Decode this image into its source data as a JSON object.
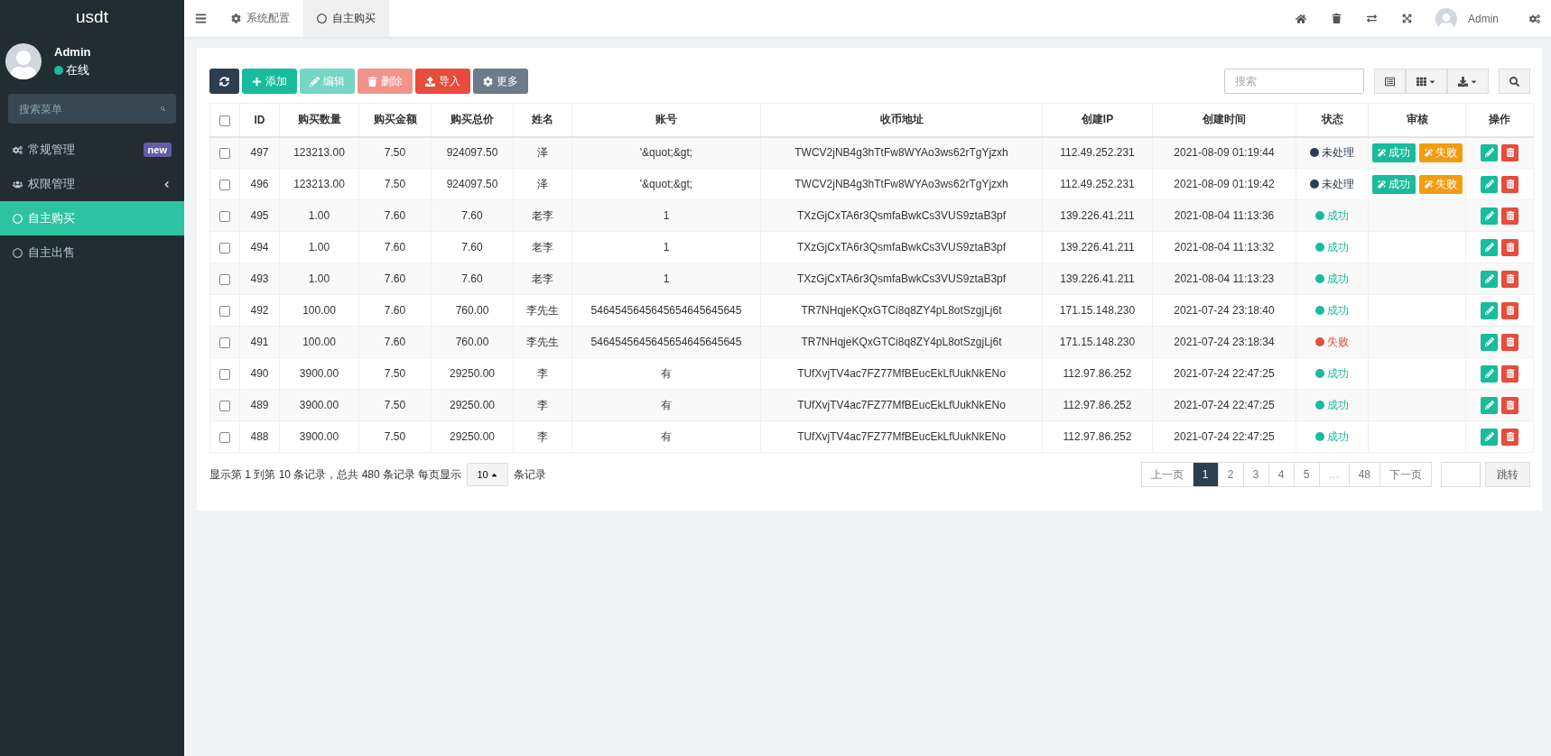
{
  "sidebar": {
    "logo": "usdt",
    "user": {
      "name": "Admin",
      "status": "在线"
    },
    "search": {
      "placeholder": "搜索菜单"
    },
    "items": [
      {
        "label": "常规管理",
        "badge": "new",
        "selected": false
      },
      {
        "label": "权限管理",
        "selected": false
      },
      {
        "label": "自主购买",
        "selected": true
      },
      {
        "label": "自主出售",
        "selected": false
      }
    ]
  },
  "topbar": {
    "tabs": [
      {
        "label": "系统配置",
        "selected": false
      },
      {
        "label": "自主购买",
        "selected": true
      }
    ],
    "user": "Admin"
  },
  "toolbar": {
    "buttons": [
      {
        "kind": "refresh",
        "disabled": false
      },
      {
        "kind": "add",
        "label": "添加",
        "disabled": false
      },
      {
        "kind": "edit",
        "label": "编辑",
        "disabled": true
      },
      {
        "kind": "delete",
        "label": "删除",
        "disabled": true
      },
      {
        "kind": "import",
        "label": "导入",
        "disabled": false
      },
      {
        "kind": "more",
        "label": "更多",
        "disabled": false
      }
    ],
    "search": {
      "placeholder": "搜索"
    }
  },
  "table": {
    "select_all": {
      "checked": false
    },
    "columns": [
      "ID",
      "购买数量",
      "购买金额",
      "购买总价",
      "姓名",
      "账号",
      "收币地址",
      "创建IP",
      "创建时间",
      "状态",
      "审核",
      "操作"
    ],
    "rows": [
      {
        "checked": false,
        "cells": [
          "497",
          "123213.00",
          "7.50",
          "924097.50",
          "泽",
          "'&quot;&gt;",
          "TWCV2jNB4g3hTtFw8WYAo3ws62rTgYjzxh",
          "112.49.252.231",
          "2021-08-09 01:19:44"
        ],
        "status": {
          "kind": "pending",
          "label": "未处理"
        },
        "review": [
          "成功",
          "失败"
        ]
      },
      {
        "checked": false,
        "cells": [
          "496",
          "123213.00",
          "7.50",
          "924097.50",
          "泽",
          "'&quot;&gt;",
          "TWCV2jNB4g3hTtFw8WYAo3ws62rTgYjzxh",
          "112.49.252.231",
          "2021-08-09 01:19:42"
        ],
        "status": {
          "kind": "pending",
          "label": "未处理"
        },
        "review": [
          "成功",
          "失败"
        ]
      },
      {
        "checked": false,
        "cells": [
          "495",
          "1.00",
          "7.60",
          "7.60",
          "老李",
          "1",
          "TXzGjCxTA6r3QsmfaBwkCs3VUS9ztaB3pf",
          "139.226.41.211",
          "2021-08-04 11:13:36"
        ],
        "status": {
          "kind": "success",
          "label": "成功"
        }
      },
      {
        "checked": false,
        "cells": [
          "494",
          "1.00",
          "7.60",
          "7.60",
          "老李",
          "1",
          "TXzGjCxTA6r3QsmfaBwkCs3VUS9ztaB3pf",
          "139.226.41.211",
          "2021-08-04 11:13:32"
        ],
        "status": {
          "kind": "success",
          "label": "成功"
        }
      },
      {
        "checked": false,
        "cells": [
          "493",
          "1.00",
          "7.60",
          "7.60",
          "老李",
          "1",
          "TXzGjCxTA6r3QsmfaBwkCs3VUS9ztaB3pf",
          "139.226.41.211",
          "2021-08-04 11:13:23"
        ],
        "status": {
          "kind": "success",
          "label": "成功"
        }
      },
      {
        "checked": false,
        "cells": [
          "492",
          "100.00",
          "7.60",
          "760.00",
          "李先生",
          "5464545645645654645645645",
          "TR7NHqjeKQxGTCi8q8ZY4pL8otSzgjLj6t",
          "171.15.148.230",
          "2021-07-24 23:18:40"
        ],
        "status": {
          "kind": "success",
          "label": "成功"
        }
      },
      {
        "checked": false,
        "cells": [
          "491",
          "100.00",
          "7.60",
          "760.00",
          "李先生",
          "5464545645645654645645645",
          "TR7NHqjeKQxGTCi8q8ZY4pL8otSzgjLj6t",
          "171.15.148.230",
          "2021-07-24 23:18:34"
        ],
        "status": {
          "kind": "fail",
          "label": "失败"
        }
      },
      {
        "checked": false,
        "cells": [
          "490",
          "3900.00",
          "7.50",
          "29250.00",
          "李",
          "有",
          "TUfXvjTV4ac7FZ77MfBEucEkLfUukNkENo",
          "112.97.86.252",
          "2021-07-24 22:47:25"
        ],
        "status": {
          "kind": "success",
          "label": "成功"
        }
      },
      {
        "checked": false,
        "cells": [
          "489",
          "3900.00",
          "7.50",
          "29250.00",
          "李",
          "有",
          "TUfXvjTV4ac7FZ77MfBEucEkLfUukNkENo",
          "112.97.86.252",
          "2021-07-24 22:47:25"
        ],
        "status": {
          "kind": "success",
          "label": "成功"
        }
      },
      {
        "checked": false,
        "cells": [
          "488",
          "3900.00",
          "7.50",
          "29250.00",
          "李",
          "有",
          "TUfXvjTV4ac7FZ77MfBEucEkLfUukNkENo",
          "112.97.86.252",
          "2021-07-24 22:47:25"
        ],
        "status": {
          "kind": "success",
          "label": "成功"
        }
      }
    ]
  },
  "footer": {
    "summary": "显示第 1 到第 10 条记录，总共 480 条记录 每页显示",
    "page_size": "10",
    "suffix": "条记录",
    "pages": [
      {
        "label": "上一页",
        "selected": false,
        "disabled": false
      },
      {
        "label": "1",
        "selected": true,
        "disabled": false
      },
      {
        "label": "2",
        "selected": false,
        "disabled": false
      },
      {
        "label": "3",
        "selected": false,
        "disabled": false
      },
      {
        "label": "4",
        "selected": false,
        "disabled": false
      },
      {
        "label": "5",
        "selected": false,
        "disabled": false
      },
      {
        "label": "…",
        "selected": false,
        "disabled": true
      },
      {
        "label": "48",
        "selected": false,
        "disabled": false
      },
      {
        "label": "下一页",
        "selected": false,
        "disabled": false
      }
    ],
    "jump": "跳转"
  }
}
